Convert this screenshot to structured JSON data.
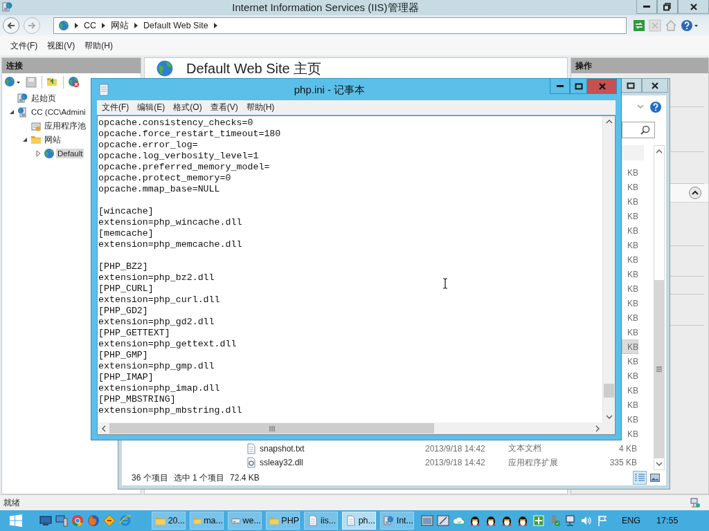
{
  "iis_window": {
    "title": "Internet Information Services (IIS)管理器",
    "breadcrumb": [
      "CC",
      "网站",
      "Default Web Site"
    ],
    "menu": [
      "文件(F)",
      "视图(V)",
      "帮助(H)"
    ],
    "connections": {
      "header": "连接",
      "tree": [
        {
          "label": "起始页",
          "kind": "start",
          "selected": false
        },
        {
          "label": "CC (CC\\Admini",
          "kind": "server",
          "expanded": true,
          "selected": false,
          "children": [
            {
              "label": "应用程序池",
              "kind": "pool",
              "selected": false
            },
            {
              "label": "网站",
              "kind": "sites",
              "expanded": true,
              "selected": false,
              "children": [
                {
                  "label": "Default",
                  "kind": "site",
                  "expanded": false,
                  "selected": true
                }
              ]
            }
          ]
        }
      ]
    },
    "page_title": "Default Web Site 主页",
    "actions_header": "操作",
    "status": "就绪"
  },
  "explorer_window": {
    "rows": [
      {
        "size": "KB",
        "selected": false
      },
      {
        "size": "KB",
        "selected": false
      },
      {
        "size": "KB",
        "selected": false
      },
      {
        "size": "KB",
        "selected": false
      },
      {
        "size": "KB",
        "selected": false
      },
      {
        "size": "KB",
        "selected": false
      },
      {
        "size": "KB",
        "selected": false
      },
      {
        "size": "KB",
        "selected": false
      },
      {
        "size": "KB",
        "selected": false
      },
      {
        "size": "KB",
        "selected": false
      },
      {
        "size": "KB",
        "selected": false
      },
      {
        "size": "KB",
        "selected": false
      },
      {
        "size": "KB",
        "selected": true
      },
      {
        "size": "KB",
        "selected": false
      },
      {
        "size": "KB",
        "selected": false
      },
      {
        "size": "KB",
        "selected": false
      },
      {
        "size": "KB",
        "selected": false
      },
      {
        "size": "KB",
        "selected": false
      },
      {
        "size": "KB",
        "selected": false
      },
      {
        "name": "snapshot.txt",
        "date": "2013/9/18 14:42",
        "type": "文本文档",
        "size": "4 KB",
        "kind": "text",
        "selected": false
      },
      {
        "name": "ssleay32.dll",
        "date": "2013/9/18 14:42",
        "type": "应用程序扩展",
        "size": "335 KB",
        "kind": "dll",
        "selected": false
      }
    ],
    "status": {
      "count": "36 个项目",
      "selection": "选中 1 个项目",
      "size": "72.4 KB"
    }
  },
  "notepad_window": {
    "title": "php.ini - 记事本",
    "menu": [
      "文件(F)",
      "编辑(E)",
      "格式(O)",
      "查看(V)",
      "帮助(H)"
    ],
    "text": "opcache.consistency_checks=0\nopcache.force_restart_timeout=180\nopcache.error_log=\nopcache.log_verbosity_level=1\nopcache.preferred_memory_model=\nopcache.protect_memory=0\nopcache.mmap_base=NULL\n\n[wincache]\nextension=php_wincache.dll\n[memcache]\nextension=php_memcache.dll\n\n[PHP_BZ2]\nextension=php_bz2.dll\n[PHP_CURL]\nextension=php_curl.dll\n[PHP_GD2]\nextension=php_gd2.dll\n[PHP_GETTEXT]\nextension=php_gettext.dll\n[PHP_GMP]\nextension=php_gmp.dll\n[PHP_IMAP]\nextension=php_imap.dll\n[PHP_MBSTRING]\nextension=php_mbstring.dll"
  },
  "taskbar": {
    "tasks": [
      {
        "label": "20...",
        "kind": "folder",
        "selected": false
      },
      {
        "label": "ma...",
        "kind": "folder",
        "selected": false
      },
      {
        "label": "we...",
        "kind": "drive",
        "selected": false
      },
      {
        "label": "PHP",
        "kind": "folder",
        "selected": false
      },
      {
        "label": "iis...",
        "kind": "notepad",
        "selected": false
      },
      {
        "label": "ph...",
        "kind": "notepad",
        "selected": true
      },
      {
        "label": "Int...",
        "kind": "iis",
        "selected": false
      }
    ],
    "language": "ENG",
    "clock": "17:55"
  }
}
